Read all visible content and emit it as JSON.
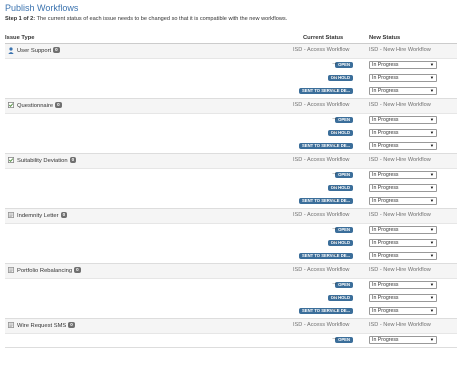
{
  "page": {
    "title": "Publish Workflows",
    "step_bold": "Step 1 of 2:",
    "step_text": "The current status of each issue needs to be changed so that it is compatible with the new workflows."
  },
  "columns": {
    "issue_type": "Issue Type",
    "current_status": "Current Status",
    "new_status": "New Status"
  },
  "colors": {
    "link": "#3b73af",
    "lozenge": "#3b6e9a",
    "badge": "#707070"
  },
  "groups": [
    {
      "icon": "user-icon",
      "name": "User Support",
      "count": "0",
      "current_workflow": "ISD - Access Workflow",
      "new_workflow": "ISD - New Hire Workflow",
      "statuses": [
        {
          "current": "OPEN",
          "new": "In Progress"
        },
        {
          "current": "ON HOLD",
          "new": "In Progress"
        },
        {
          "current": "SENT TO SERVICE DE...",
          "new": "In Progress"
        }
      ]
    },
    {
      "icon": "checkbox-icon",
      "name": "Questionnaire",
      "count": "0",
      "current_workflow": "ISD - Access Workflow",
      "new_workflow": "ISD - New Hire Workflow",
      "statuses": [
        {
          "current": "OPEN",
          "new": "In Progress"
        },
        {
          "current": "ON HOLD",
          "new": "In Progress"
        },
        {
          "current": "SENT TO SERVICE DE...",
          "new": "In Progress"
        }
      ]
    },
    {
      "icon": "checkbox-icon",
      "name": "Suitability Deviation",
      "count": "0",
      "current_workflow": "ISD - Access Workflow",
      "new_workflow": "ISD - New Hire Workflow",
      "statuses": [
        {
          "current": "OPEN",
          "new": "In Progress"
        },
        {
          "current": "ON HOLD",
          "new": "In Progress"
        },
        {
          "current": "SENT TO SERVICE DE...",
          "new": "In Progress"
        }
      ]
    },
    {
      "icon": "document-icon",
      "name": "Indemnity Letter",
      "count": "0",
      "current_workflow": "ISD - Access Workflow",
      "new_workflow": "ISD - New Hire Workflow",
      "statuses": [
        {
          "current": "OPEN",
          "new": "In Progress"
        },
        {
          "current": "ON HOLD",
          "new": "In Progress"
        },
        {
          "current": "SENT TO SERVICE DE...",
          "new": "In Progress"
        }
      ]
    },
    {
      "icon": "document-icon",
      "name": "Portfolio Rebalancing",
      "count": "0",
      "current_workflow": "ISD - Access Workflow",
      "new_workflow": "ISD - New Hire Workflow",
      "statuses": [
        {
          "current": "OPEN",
          "new": "In Progress"
        },
        {
          "current": "ON HOLD",
          "new": "In Progress"
        },
        {
          "current": "SENT TO SERVICE DE...",
          "new": "In Progress"
        }
      ]
    },
    {
      "icon": "document-icon",
      "name": "Wire Request SMS",
      "count": "0",
      "current_workflow": "ISD - Access Workflow",
      "new_workflow": "ISD - New Hire Workflow",
      "statuses": [
        {
          "current": "OPEN",
          "new": "In Progress"
        }
      ]
    }
  ]
}
